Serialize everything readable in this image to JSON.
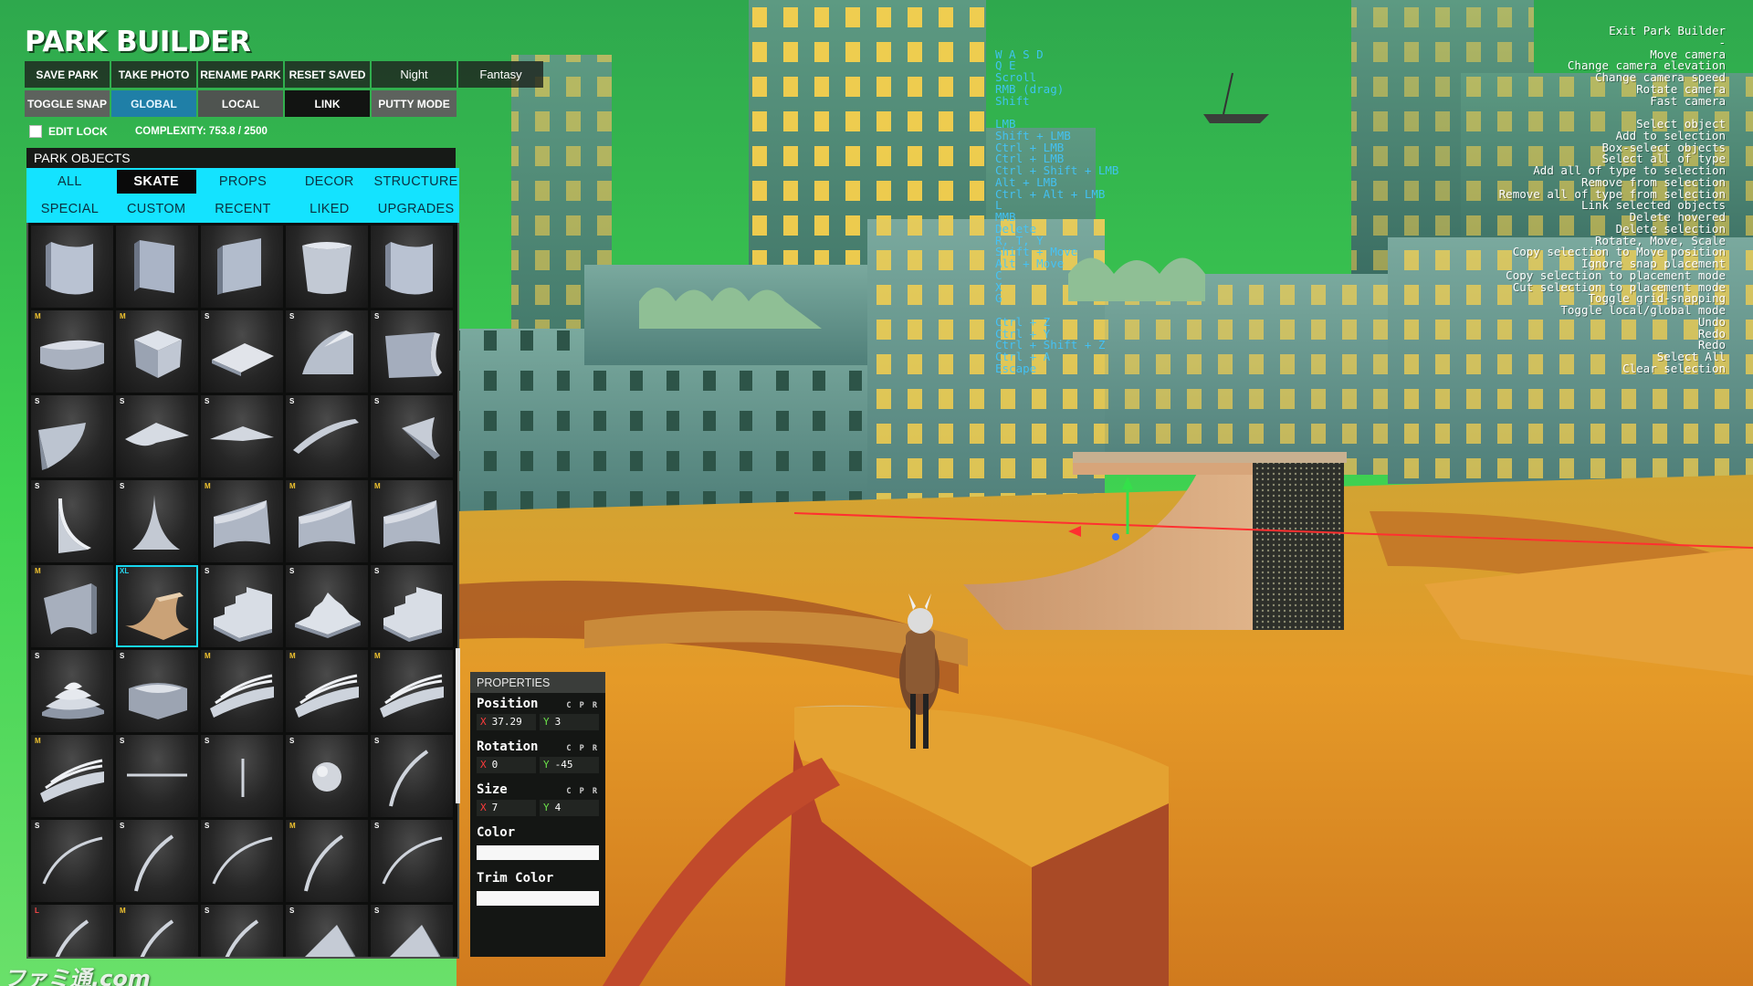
{
  "title": "PARK BUILDER",
  "toolbar": {
    "row1": [
      {
        "label": "SAVE PARK",
        "style": "default"
      },
      {
        "label": "TAKE PHOTO",
        "style": "default"
      },
      {
        "label": "RENAME PARK",
        "style": "default"
      },
      {
        "label": "RESET SAVED",
        "style": "default"
      },
      {
        "label": "Night",
        "style": "normal"
      },
      {
        "label": "Fantasy",
        "style": "normal"
      }
    ],
    "row2": [
      {
        "label": "TOGGLE SNAP",
        "style": "gray"
      },
      {
        "label": "GLOBAL",
        "style": "blue"
      },
      {
        "label": "LOCAL",
        "style": "midgray"
      },
      {
        "label": "LINK",
        "style": "dark"
      },
      {
        "label": "PUTTY MODE",
        "style": "gray"
      }
    ]
  },
  "edit_lock": {
    "label": "EDIT LOCK",
    "checked": false
  },
  "complexity": "COMPLEXITY: 753.8 / 2500",
  "park_objects": {
    "header": "PARK OBJECTS",
    "tabs_row1": [
      "ALL",
      "SKATE",
      "PROPS",
      "DECOR",
      "STRUCTURE"
    ],
    "tabs_row2": [
      "SPECIAL",
      "CUSTOM",
      "RECENT",
      "LIKED",
      "UPGRADES"
    ],
    "active_tab": "SKATE",
    "tiles": [
      {
        "badge": "",
        "shape": "curved-wall"
      },
      {
        "badge": "",
        "shape": "wall-panel"
      },
      {
        "badge": "",
        "shape": "wall-flat"
      },
      {
        "badge": "",
        "shape": "bowl-wall"
      },
      {
        "badge": "",
        "shape": "curved-wall"
      },
      {
        "badge": "M",
        "shape": "bowl-corner"
      },
      {
        "badge": "M",
        "shape": "box"
      },
      {
        "badge": "S",
        "shape": "flat-plate"
      },
      {
        "badge": "S",
        "shape": "quarter-pipe-corner"
      },
      {
        "badge": "S",
        "shape": "quarter-pipe"
      },
      {
        "badge": "S",
        "shape": "extension"
      },
      {
        "badge": "S",
        "shape": "hip"
      },
      {
        "badge": "S",
        "shape": "hip-small"
      },
      {
        "badge": "S",
        "shape": "spine"
      },
      {
        "badge": "S",
        "shape": "extension-flat"
      },
      {
        "badge": "S",
        "shape": "tall-corner"
      },
      {
        "badge": "S",
        "shape": "tall-spike"
      },
      {
        "badge": "M",
        "shape": "wedge-wall"
      },
      {
        "badge": "M",
        "shape": "wedge-wall"
      },
      {
        "badge": "M",
        "shape": "wedge-wall"
      },
      {
        "badge": "M",
        "shape": "vert-corner"
      },
      {
        "badge": "XL",
        "shape": "halfpipe",
        "selected": true
      },
      {
        "badge": "S",
        "shape": "stairs"
      },
      {
        "badge": "S",
        "shape": "pyramid-stairs"
      },
      {
        "badge": "S",
        "shape": "stairs"
      },
      {
        "badge": "S",
        "shape": "round-stairs"
      },
      {
        "badge": "S",
        "shape": "round-stairs-box"
      },
      {
        "badge": "M",
        "shape": "curved-stairs"
      },
      {
        "badge": "M",
        "shape": "curved-stairs"
      },
      {
        "badge": "M",
        "shape": "curved-stairs"
      },
      {
        "badge": "M",
        "shape": "curved-stairs"
      },
      {
        "badge": "S",
        "shape": "rail-flat"
      },
      {
        "badge": "S",
        "shape": "rail-vertical"
      },
      {
        "badge": "S",
        "shape": "sphere"
      },
      {
        "badge": "S",
        "shape": "rail-curve"
      },
      {
        "badge": "S",
        "shape": "rail-arc"
      },
      {
        "badge": "S",
        "shape": "rail-curve"
      },
      {
        "badge": "S",
        "shape": "rail-arc"
      },
      {
        "badge": "M",
        "shape": "rail-curve"
      },
      {
        "badge": "S",
        "shape": "rail-arc"
      },
      {
        "badge": "L",
        "shape": "rail-curve"
      },
      {
        "badge": "M",
        "shape": "rail-curve"
      },
      {
        "badge": "S",
        "shape": "rail-curve"
      },
      {
        "badge": "S",
        "shape": "wedge-ramp"
      },
      {
        "badge": "S",
        "shape": "wedge-ramp"
      }
    ]
  },
  "properties": {
    "header": "PROPERTIES",
    "cpr": "C P R",
    "position": {
      "label": "Position",
      "x_label": "X",
      "x": "37.29",
      "y_label": "Y",
      "y": "3"
    },
    "rotation": {
      "label": "Rotation",
      "x_label": "X",
      "x": "0",
      "y_label": "Y",
      "y": "-45"
    },
    "size": {
      "label": "Size",
      "x_label": "X",
      "x": "7",
      "y_label": "Y",
      "y": "4"
    },
    "color": {
      "label": "Color",
      "value": "#f7f7f7"
    },
    "trim_color": {
      "label": "Trim Color",
      "value": "#f7f7f7"
    }
  },
  "help": [
    {
      "key": "",
      "action": "Exit Park Builder"
    },
    {
      "key": "",
      "action": "-"
    },
    {
      "key": "W A S D",
      "action": "Move camera"
    },
    {
      "key": "Q E",
      "action": "Change camera elevation"
    },
    {
      "key": "Scroll",
      "action": "Change camera speed"
    },
    {
      "key": "RMB (drag)",
      "action": "Rotate camera"
    },
    {
      "key": "Shift",
      "action": "Fast camera"
    },
    {
      "key": "",
      "action": ""
    },
    {
      "key": "LMB",
      "action": "Select object"
    },
    {
      "key": "Shift + LMB",
      "action": "Add to selection"
    },
    {
      "key": "Ctrl + LMB",
      "action": "Box-select objects"
    },
    {
      "key": "Ctrl + LMB",
      "action": "Select all of type"
    },
    {
      "key": "Ctrl + Shift + LMB",
      "action": "Add all of type to selection"
    },
    {
      "key": "Alt + LMB",
      "action": "Remove from selection"
    },
    {
      "key": "Ctrl + Alt + LMB",
      "action": "Remove all of type from selection"
    },
    {
      "key": "L",
      "action": "Link selected objects"
    },
    {
      "key": "MMB",
      "action": "Delete hovered"
    },
    {
      "key": "Delete",
      "action": "Delete selection"
    },
    {
      "key": "R, T, Y",
      "action": "Rotate, Move, Scale"
    },
    {
      "key": "Shift + Move",
      "action": "Copy selection to Move position"
    },
    {
      "key": "Alt + Move",
      "action": "Ignore snap placement"
    },
    {
      "key": "C",
      "action": "Copy selection to placement mode"
    },
    {
      "key": "X",
      "action": "Cut selection to placement mode"
    },
    {
      "key": "G",
      "action": "Toggle grid-snapping"
    },
    {
      "key": "",
      "action": "Toggle local/global mode"
    },
    {
      "key": "Ctrl + Z",
      "action": "Undo"
    },
    {
      "key": "Ctrl + Y",
      "action": "Redo"
    },
    {
      "key": "Ctrl + Shift + Z",
      "action": "Redo"
    },
    {
      "key": "Ctrl + A",
      "action": "Select All"
    },
    {
      "key": "Escape",
      "action": "Clear selection"
    }
  ],
  "watermark": "ファミ通.com",
  "colors": {
    "accent_cyan": "#14e3ff",
    "global_blue": "#1f7fa7",
    "axis_x": "#ff3b3b",
    "axis_y": "#6be34a",
    "help_key": "#41c6ff"
  }
}
